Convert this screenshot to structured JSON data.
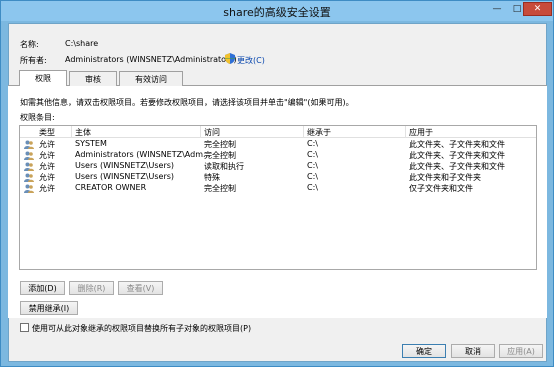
{
  "window": {
    "title": "share的高级安全设置"
  },
  "window_controls": {
    "minimize": "—",
    "maximize": "□",
    "close": "✕"
  },
  "info": {
    "name_label": "名称:",
    "name_value": "C:\\share",
    "owner_label": "所有者:",
    "owner_value": "Administrators (WINSNETZ\\Administrators)",
    "change_link": "更改(C)"
  },
  "tabs": [
    {
      "label": "权限",
      "active": true
    },
    {
      "label": "审核",
      "active": false
    },
    {
      "label": "有效访问",
      "active": false
    }
  ],
  "instructions": "如需其他信息，请双击权限项目。若要修改权限项目，请选择该项目并单击\"编辑\"(如果可用)。",
  "entries_label": "权限条目:",
  "columns": [
    "类型",
    "主体",
    "访问",
    "继承于",
    "应用于"
  ],
  "rows": [
    {
      "type": "允许",
      "principal": "SYSTEM",
      "access": "完全控制",
      "inherited": "C:\\",
      "applies": "此文件夹、子文件夹和文件"
    },
    {
      "type": "允许",
      "principal": "Administrators (WINSNETZ\\Adm...",
      "access": "完全控制",
      "inherited": "C:\\",
      "applies": "此文件夹、子文件夹和文件"
    },
    {
      "type": "允许",
      "principal": "Users (WINSNETZ\\Users)",
      "access": "读取和执行",
      "inherited": "C:\\",
      "applies": "此文件夹、子文件夹和文件"
    },
    {
      "type": "允许",
      "principal": "Users (WINSNETZ\\Users)",
      "access": "特殊",
      "inherited": "C:\\",
      "applies": "此文件夹和子文件夹"
    },
    {
      "type": "允许",
      "principal": "CREATOR OWNER",
      "access": "完全控制",
      "inherited": "C:\\",
      "applies": "仅子文件夹和文件"
    }
  ],
  "buttons": {
    "add": "添加(D)",
    "remove": "删除(R)",
    "view": "查看(V)",
    "disable_inheritance": "禁用继承(I)",
    "ok": "确定",
    "cancel": "取消",
    "apply": "应用(A)"
  },
  "replace_checkbox": {
    "label": "使用可从此对象继承的权限项目替换所有子对象的权限项目(P)",
    "checked": false
  },
  "colors": {
    "title_bar": "#8cc6ee",
    "close_button": "#c74b3b",
    "link": "#0645ad"
  }
}
